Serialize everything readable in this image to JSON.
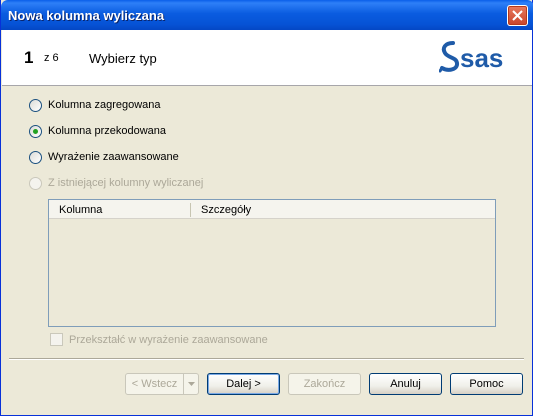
{
  "window": {
    "title": "Nowa kolumna wyliczana"
  },
  "header": {
    "step_number": "1",
    "step_of": "z 6",
    "step_title": "Wybierz typ",
    "logo_text": "sas"
  },
  "options": [
    {
      "label": "Kolumna zagregowana",
      "checked": false,
      "disabled": false
    },
    {
      "label": "Kolumna przekodowana",
      "checked": true,
      "disabled": false
    },
    {
      "label": "Wyrażenie zaawansowane",
      "checked": false,
      "disabled": false
    },
    {
      "label": "Z istniejącej kolumny wyliczanej",
      "checked": false,
      "disabled": true
    }
  ],
  "grid": {
    "columns": [
      "Kolumna",
      "Szczegóły"
    ]
  },
  "convert_checkbox": {
    "label": "Przekształć w wyrażenie zaawansowane",
    "checked": false,
    "disabled": true
  },
  "buttons": {
    "back": "< Wstecz",
    "next": "Dalej >",
    "finish": "Zakończ",
    "cancel": "Anuluj",
    "help": "Pomoc"
  },
  "colors": {
    "title_bar": "#0A5CE0",
    "radio_selected": "#21A121",
    "logo": "#1F5BA8",
    "dialog_bg": "#ECE9D8"
  }
}
